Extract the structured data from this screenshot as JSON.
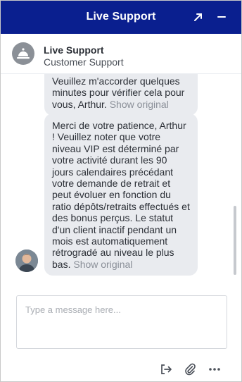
{
  "header": {
    "title": "Live Support",
    "popout_icon": "popout-arrow-icon",
    "minimize_icon": "minimize-icon"
  },
  "agent": {
    "name": "Live Support",
    "role": "Customer Support",
    "avatar_icon": "service-bell-icon"
  },
  "messages": [
    {
      "text": "Veuillez m'accorder quelques minutes pour vérifier cela pour vous, Arthur.",
      "show_original": "Show original"
    },
    {
      "text": "Merci de votre patience, Arthur ! Veuillez noter que votre niveau VIP est déterminé par votre activité durant les 90 jours calendaires précédant votre demande de retrait et peut évoluer en fonction du ratio dépôts/retraits effectués et des bonus perçus. Le statut d'un client inactif pendant un mois est automatiquement rétrogradé au niveau le plus bas.",
      "show_original": "Show original"
    }
  ],
  "composer": {
    "placeholder": "Type a message here...",
    "value": ""
  },
  "toolbar": {
    "icons": [
      "exit-icon",
      "paperclip-icon",
      "more-icon"
    ]
  },
  "colors": {
    "header_bg": "#0a1f8f",
    "bubble_bg": "#e9ebef",
    "muted_text": "#8a8f98"
  }
}
